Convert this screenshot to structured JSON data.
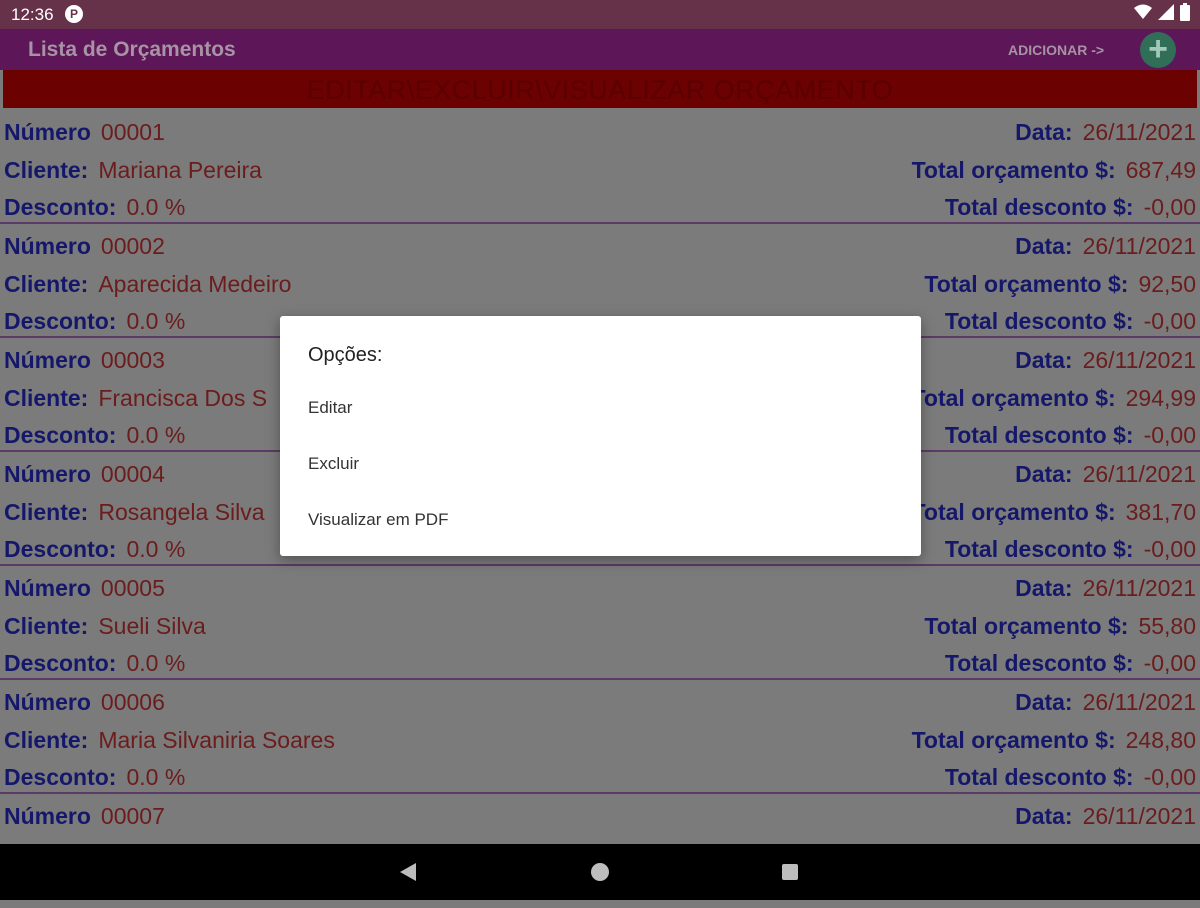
{
  "status_bar": {
    "time": "12:36",
    "notif_icon": "P"
  },
  "app_bar": {
    "title": "Lista de Orçamentos",
    "add_label": "ADICIONAR ->",
    "add_icon": "+"
  },
  "banner": {
    "text": "EDITAR\\EXCLUIR\\VISUALIZAR ORÇAMENTO"
  },
  "labels": {
    "numero": "Número",
    "data": "Data:",
    "cliente": "Cliente:",
    "total": "Total orçamento $:",
    "desconto": "Desconto:",
    "total_desconto": "Total desconto $:"
  },
  "items": [
    {
      "numero": "00001",
      "data": "26/11/2021",
      "cliente": "Mariana Pereira",
      "total": "687,49",
      "desconto": "0.0 %",
      "total_desconto": "-0,00"
    },
    {
      "numero": "00002",
      "data": "26/11/2021",
      "cliente": "Aparecida Medeiro",
      "total": "92,50",
      "desconto": "0.0 %",
      "total_desconto": "-0,00"
    },
    {
      "numero": "00003",
      "data": "26/11/2021",
      "cliente": "Francisca Dos S",
      "total": "294,99",
      "desconto": "0.0 %",
      "total_desconto": "-0,00"
    },
    {
      "numero": "00004",
      "data": "26/11/2021",
      "cliente": "Rosangela Silva",
      "total": "381,70",
      "desconto": "0.0 %",
      "total_desconto": "-0,00"
    },
    {
      "numero": "00005",
      "data": "26/11/2021",
      "cliente": "Sueli Silva",
      "total": "55,80",
      "desconto": "0.0 %",
      "total_desconto": "-0,00"
    },
    {
      "numero": "00006",
      "data": "26/11/2021",
      "cliente": "Maria Silvaniria Soares",
      "total": "248,80",
      "desconto": "0.0 %",
      "total_desconto": "-0,00"
    },
    {
      "numero": "00007",
      "data": "26/11/2021"
    }
  ],
  "dialog": {
    "title": "Opções:",
    "options": [
      "Editar",
      "Excluir",
      "Visualizar em PDF"
    ]
  },
  "colors": {
    "appbar": "#5d1657",
    "banner": "#6c0101",
    "label": "#15186a",
    "value": "#6b1c1c"
  }
}
